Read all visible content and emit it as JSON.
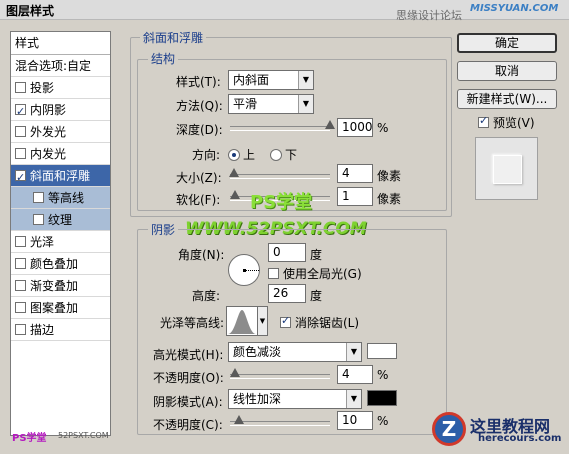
{
  "window": {
    "title": "图层样式"
  },
  "watermark": {
    "top_text": "思缘设计论坛",
    "top_logo": "MISSYUAN.COM",
    "bottom_left": "PS学堂",
    "bottom_left_url": "52PSXT.COM",
    "center_title": "PS学堂",
    "center_url": "WWW.52PSXT.COM",
    "site_logo_letter": "Z",
    "site_name": "这里教程网",
    "site_url": "herecours.com"
  },
  "styles_panel": {
    "header": "样式",
    "blend_options": "混合选项:自定",
    "items": [
      {
        "label": "投影",
        "checked": false
      },
      {
        "label": "内阴影",
        "checked": true
      },
      {
        "label": "外发光",
        "checked": false
      },
      {
        "label": "内发光",
        "checked": false
      },
      {
        "label": "斜面和浮雕",
        "checked": true,
        "selected": true
      },
      {
        "label": "等高线",
        "checked": false,
        "sub": true
      },
      {
        "label": "纹理",
        "checked": false,
        "sub": true
      },
      {
        "label": "光泽",
        "checked": false
      },
      {
        "label": "颜色叠加",
        "checked": false
      },
      {
        "label": "渐变叠加",
        "checked": false
      },
      {
        "label": "图案叠加",
        "checked": false
      },
      {
        "label": "描边",
        "checked": false
      }
    ]
  },
  "bevel": {
    "group_title": "斜面和浮雕",
    "structure_title": "结构",
    "style_label": "样式(T):",
    "style_value": "内斜面",
    "method_label": "方法(Q):",
    "method_value": "平滑",
    "depth_label": "深度(D):",
    "depth_value": "1000",
    "depth_unit": "%",
    "depth_level": 100,
    "direction_label": "方向:",
    "direction_up": "上",
    "direction_down": "下",
    "size_label": "大小(Z):",
    "size_value": "4",
    "size_unit": "像素",
    "soften_label": "软化(F):",
    "soften_value": "1",
    "soften_unit": "像素"
  },
  "shading": {
    "title": "阴影",
    "angle_label": "角度(N):",
    "angle_value": "0",
    "angle_unit": "度",
    "global_light": "使用全局光(G)",
    "altitude_label": "高度:",
    "altitude_value": "26",
    "altitude_unit": "度",
    "gloss_label": "光泽等高线:",
    "antialias": "消除锯齿(L)",
    "highlight_label": "高光模式(H):",
    "highlight_value": "颜色减淡",
    "highlight_color": "#ffffff",
    "hl_opacity_label": "不透明度(O):",
    "hl_opacity_value": "4",
    "hl_opacity_unit": "%",
    "shadow_label": "阴影模式(A):",
    "shadow_value": "线性加深",
    "shadow_color": "#000000",
    "sh_opacity_label": "不透明度(C):",
    "sh_opacity_value": "10",
    "sh_opacity_unit": "%"
  },
  "buttons": {
    "ok": "确定",
    "cancel": "取消",
    "new_style": "新建样式(W)...",
    "preview": "预览(V)"
  }
}
